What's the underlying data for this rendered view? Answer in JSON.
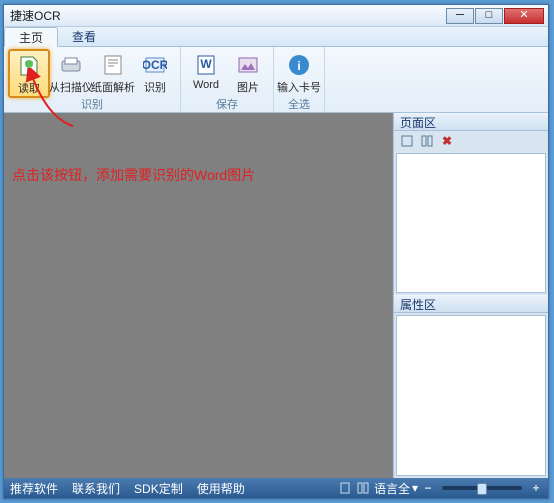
{
  "title": "捷速OCR",
  "menu": {
    "home": "主页",
    "view": "查看"
  },
  "ribbon": {
    "read_btn": "读取",
    "scanner_btn": "从扫描仪",
    "parse_btn": "纸面解析",
    "recognize_btn": "识别",
    "word_btn": "Word",
    "image_btn": "图片",
    "card_btn": "输入卡号",
    "group_recognize": "识别",
    "group_save": "保存",
    "group_all": "全选"
  },
  "annotation_text": "点击该按钮，添加需要识别的Word图片",
  "side": {
    "pages_title": "页面区",
    "props_title": "属性区"
  },
  "status": {
    "recommend": "推荐软件",
    "contact": "联系我们",
    "sdk": "SDK定制",
    "help": "使用帮助",
    "lang_label": "语言全"
  }
}
